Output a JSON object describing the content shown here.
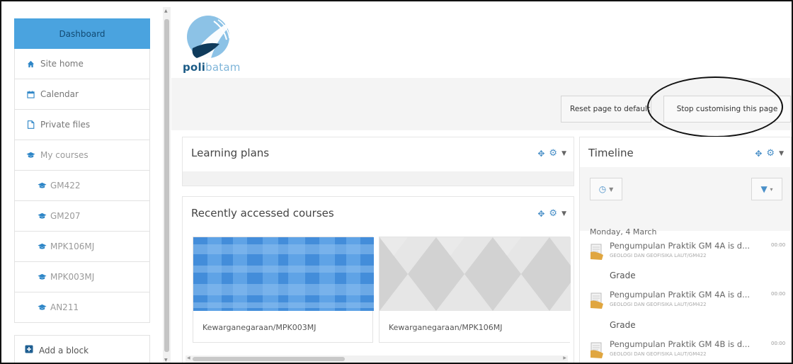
{
  "sidebar": {
    "items": [
      {
        "label": "Dashboard",
        "icon": "dashboard"
      },
      {
        "label": "Site home",
        "icon": "home-icon"
      },
      {
        "label": "Calendar",
        "icon": "calendar-icon"
      },
      {
        "label": "Private files",
        "icon": "file-icon"
      },
      {
        "label": "My courses",
        "icon": "graduation-cap-icon"
      }
    ],
    "courses": [
      "GM422",
      "GM207",
      "MPK106MJ",
      "MPK003MJ",
      "AN211"
    ],
    "add_block": "Add a block"
  },
  "header": {
    "logo_part1": "poli",
    "logo_part2": "batam"
  },
  "buttons": {
    "reset": "Reset page to default",
    "stop": "Stop customising this page"
  },
  "learning_plans": {
    "title": "Learning plans"
  },
  "recent_courses": {
    "title": "Recently accessed courses",
    "courses": [
      {
        "name": "Kewarganegaraan/MPK003MJ"
      },
      {
        "name": "Kewarganegaraan/MPK106MJ"
      }
    ]
  },
  "timeline": {
    "title": "Timeline",
    "date": "Monday, 4 March",
    "events": [
      {
        "title": "Pengumpulan Praktik GM 4A is d...",
        "time": "00:00",
        "subtitle": "GEOLOGI DAN GEOFISIKA LAUT/GM422",
        "action": "Grade"
      },
      {
        "title": "Pengumpulan Praktik GM 4A is d...",
        "time": "00:00",
        "subtitle": "GEOLOGI DAN GEOFISIKA LAUT/GM422",
        "action": "Grade"
      },
      {
        "title": "Pengumpulan Praktik GM 4B is d...",
        "time": "00:00",
        "subtitle": "GEOLOGI DAN GEOFISIKA LAUT/GM422"
      }
    ]
  },
  "colors": {
    "accent": "#4aa3df",
    "link_blue": "#2e86c7",
    "logo_dark": "#1b5b86",
    "logo_light": "#7fb5d9"
  }
}
